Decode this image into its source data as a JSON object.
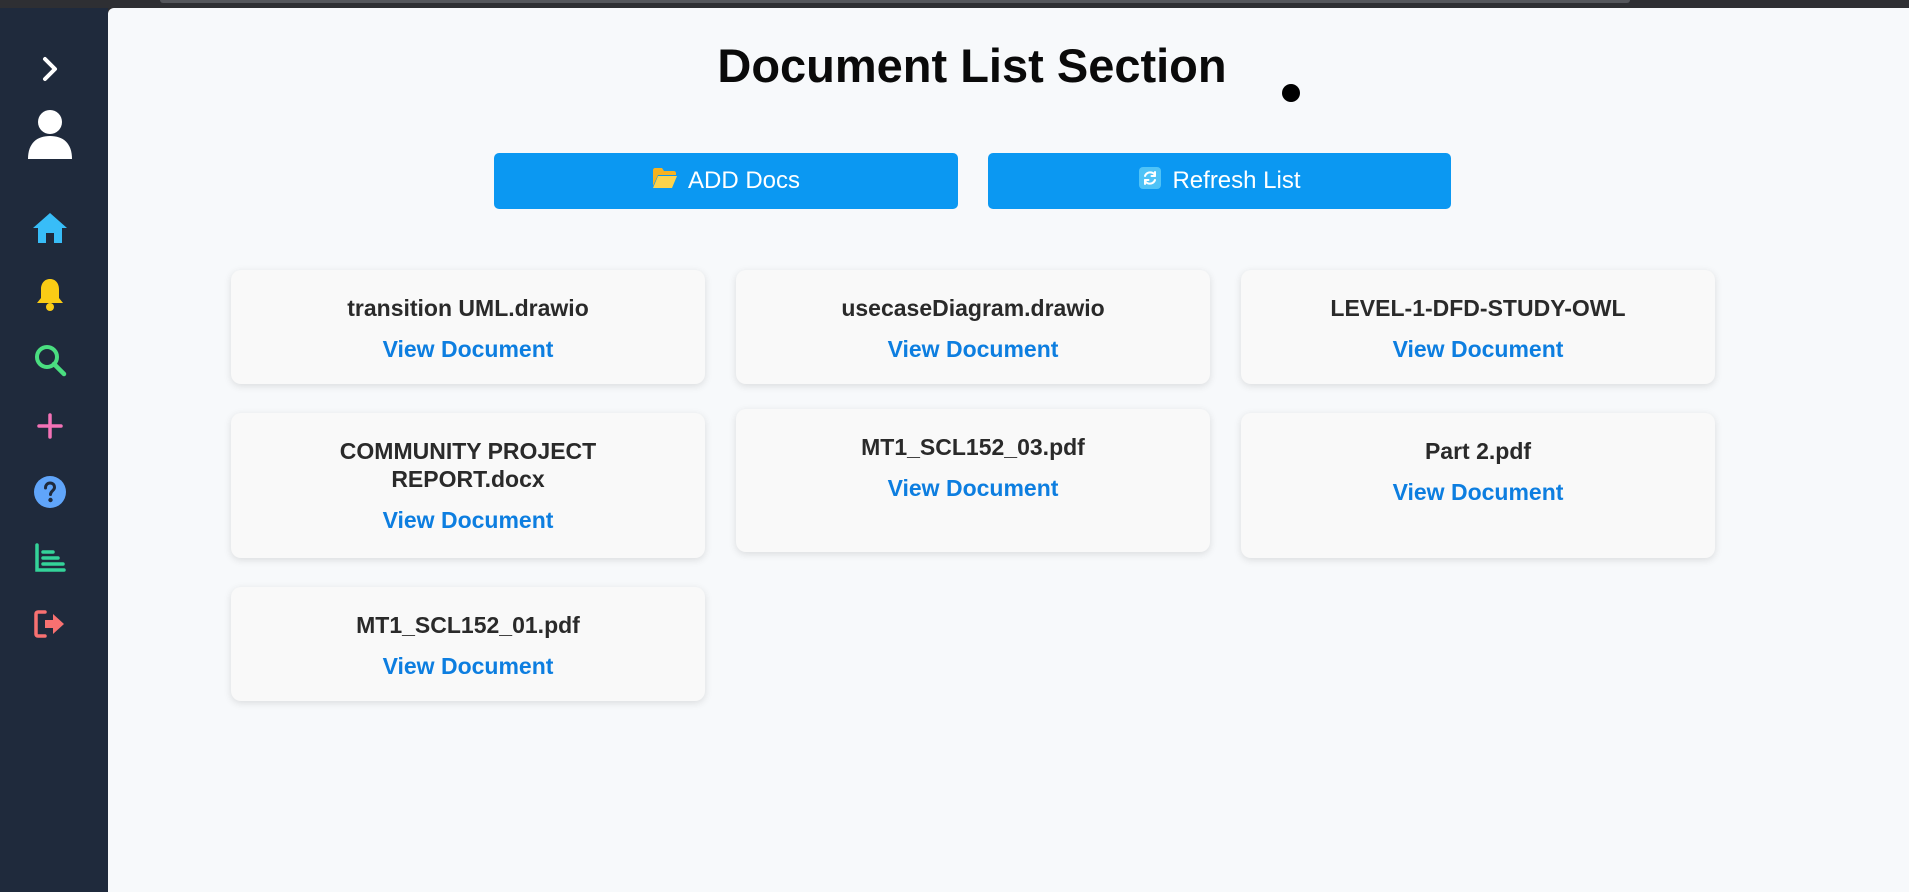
{
  "page": {
    "title": "Document List Section"
  },
  "sidebar": {
    "items": [
      {
        "icon": "chevron-right-icon",
        "color": "#ffffff"
      },
      {
        "icon": "user-icon",
        "color": "#ffffff"
      },
      {
        "icon": "home-icon",
        "color": "#38bdf8"
      },
      {
        "icon": "bell-icon",
        "color": "#facc15"
      },
      {
        "icon": "search-icon",
        "color": "#4ade80"
      },
      {
        "icon": "plus-icon",
        "color": "#f472b6"
      },
      {
        "icon": "help-icon",
        "color": "#60a5fa"
      },
      {
        "icon": "chart-icon",
        "color": "#34d399"
      },
      {
        "icon": "logout-icon",
        "color": "#f87171"
      }
    ]
  },
  "actions": {
    "add_label": "ADD Docs",
    "refresh_label": "Refresh List",
    "button_color": "#0b98f2"
  },
  "documents": [
    {
      "name": "transition UML.drawio",
      "link": "View Document"
    },
    {
      "name": "usecaseDiagram.drawio",
      "link": "View Document"
    },
    {
      "name": "LEVEL-1-DFD-STUDY-OWL",
      "link": "View Document"
    },
    {
      "name": "COMMUNITY PROJECT REPORT.docx",
      "link": "View Document"
    },
    {
      "name": "MT1_SCL152_03.pdf",
      "link": "View Document"
    },
    {
      "name": "Part 2.pdf",
      "link": "View Document"
    },
    {
      "name": "MT1_SCL152_01.pdf",
      "link": "View Document"
    }
  ]
}
